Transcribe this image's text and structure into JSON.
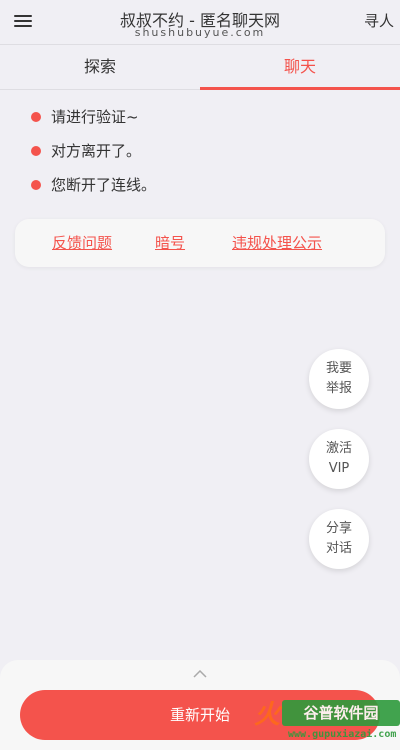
{
  "header": {
    "title": "叔叔不约 - 匿名聊天网",
    "subtitle": "shushubuyue.com",
    "right_label": "寻人"
  },
  "tabs": [
    {
      "label": "探索",
      "active": false
    },
    {
      "label": "聊天",
      "active": true
    }
  ],
  "messages": [
    "请进行验证~",
    "对方离开了。",
    "您断开了连线。"
  ],
  "links": {
    "feedback": "反馈问题",
    "code": "暗号",
    "violation": "违规处理公示"
  },
  "fabs": {
    "report": [
      "我要",
      "举报"
    ],
    "vip": [
      "激活",
      "VIP"
    ],
    "share": [
      "分享",
      "对话"
    ]
  },
  "bottom": {
    "restart_label": "重新开始"
  },
  "watermark": {
    "brand": "谷普软件园",
    "url": "www.gupuxiazai.com"
  },
  "colors": {
    "accent": "#f4534c",
    "background": "#f0eff4"
  }
}
